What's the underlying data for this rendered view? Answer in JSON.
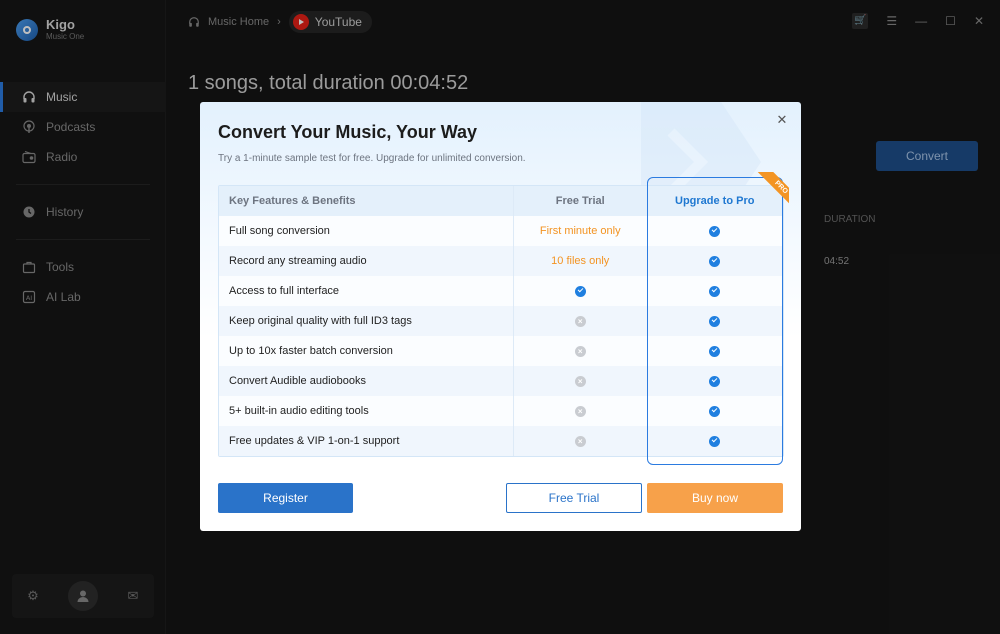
{
  "app": {
    "brand_name": "Kigo",
    "brand_sub": "Music One"
  },
  "sidebar": {
    "items": [
      {
        "label": "Music",
        "icon": "headphones-icon",
        "active": true
      },
      {
        "label": "Podcasts",
        "icon": "podcast-icon",
        "active": false
      },
      {
        "label": "Radio",
        "icon": "radio-icon",
        "active": false
      },
      {
        "label": "History",
        "icon": "history-icon",
        "active": false
      },
      {
        "label": "Tools",
        "icon": "tools-icon",
        "active": false
      },
      {
        "label": "AI Lab",
        "icon": "ai-lab-icon",
        "active": false
      }
    ]
  },
  "topbar": {
    "crumb_home": "Music Home",
    "crumb_current": "YouTube"
  },
  "main": {
    "songs_title": "1 songs, total duration 00:04:52",
    "convert_label": "Convert",
    "duration_header": "DURATION",
    "duration_value": "04:52"
  },
  "modal": {
    "title": "Convert Your Music, Your Way",
    "subtitle": "Try a 1-minute sample test for free. Upgrade for unlimited conversion.",
    "headers": {
      "features": "Key Features & Benefits",
      "free": "Free Trial",
      "pro": "Upgrade to Pro"
    },
    "pro_badge": "PRO",
    "rows": [
      {
        "feature": "Full song conversion",
        "free": "First minute only",
        "free_kind": "text",
        "pro": "check"
      },
      {
        "feature": "Record any streaming audio",
        "free": "10 files only",
        "free_kind": "text",
        "pro": "check"
      },
      {
        "feature": "Access to full interface",
        "free": "check",
        "free_kind": "check",
        "pro": "check"
      },
      {
        "feature": "Keep original quality with full ID3 tags",
        "free": "cross",
        "free_kind": "cross",
        "pro": "check"
      },
      {
        "feature": "Up to 10x faster batch conversion",
        "free": "cross",
        "free_kind": "cross",
        "pro": "check"
      },
      {
        "feature": "Convert Audible audiobooks",
        "free": "cross",
        "free_kind": "cross",
        "pro": "check"
      },
      {
        "feature": "5+ built-in audio editing tools",
        "free": "cross",
        "free_kind": "cross",
        "pro": "check"
      },
      {
        "feature": "Free updates & VIP 1-on-1 support",
        "free": "cross",
        "free_kind": "cross",
        "pro": "check"
      }
    ],
    "buttons": {
      "register": "Register",
      "free_trial": "Free Trial",
      "buy_now": "Buy now"
    }
  },
  "colors": {
    "accent": "#2a73c9",
    "orange": "#f39423",
    "buy": "#f7a14a"
  }
}
